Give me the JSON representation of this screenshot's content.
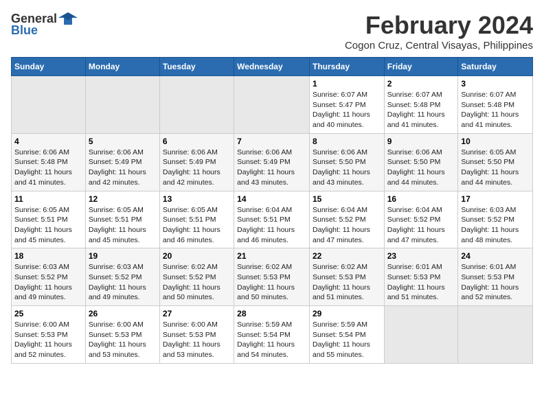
{
  "logo": {
    "text_general": "General",
    "text_blue": "Blue",
    "icon": "▶"
  },
  "title": "February 2024",
  "subtitle": "Cogon Cruz, Central Visayas, Philippines",
  "days_of_week": [
    "Sunday",
    "Monday",
    "Tuesday",
    "Wednesday",
    "Thursday",
    "Friday",
    "Saturday"
  ],
  "weeks": [
    [
      {
        "day": "",
        "info": ""
      },
      {
        "day": "",
        "info": ""
      },
      {
        "day": "",
        "info": ""
      },
      {
        "day": "",
        "info": ""
      },
      {
        "day": "1",
        "info": "Sunrise: 6:07 AM\nSunset: 5:47 PM\nDaylight: 11 hours and 40 minutes."
      },
      {
        "day": "2",
        "info": "Sunrise: 6:07 AM\nSunset: 5:48 PM\nDaylight: 11 hours and 41 minutes."
      },
      {
        "day": "3",
        "info": "Sunrise: 6:07 AM\nSunset: 5:48 PM\nDaylight: 11 hours and 41 minutes."
      }
    ],
    [
      {
        "day": "4",
        "info": "Sunrise: 6:06 AM\nSunset: 5:48 PM\nDaylight: 11 hours and 41 minutes."
      },
      {
        "day": "5",
        "info": "Sunrise: 6:06 AM\nSunset: 5:49 PM\nDaylight: 11 hours and 42 minutes."
      },
      {
        "day": "6",
        "info": "Sunrise: 6:06 AM\nSunset: 5:49 PM\nDaylight: 11 hours and 42 minutes."
      },
      {
        "day": "7",
        "info": "Sunrise: 6:06 AM\nSunset: 5:49 PM\nDaylight: 11 hours and 43 minutes."
      },
      {
        "day": "8",
        "info": "Sunrise: 6:06 AM\nSunset: 5:50 PM\nDaylight: 11 hours and 43 minutes."
      },
      {
        "day": "9",
        "info": "Sunrise: 6:06 AM\nSunset: 5:50 PM\nDaylight: 11 hours and 44 minutes."
      },
      {
        "day": "10",
        "info": "Sunrise: 6:05 AM\nSunset: 5:50 PM\nDaylight: 11 hours and 44 minutes."
      }
    ],
    [
      {
        "day": "11",
        "info": "Sunrise: 6:05 AM\nSunset: 5:51 PM\nDaylight: 11 hours and 45 minutes."
      },
      {
        "day": "12",
        "info": "Sunrise: 6:05 AM\nSunset: 5:51 PM\nDaylight: 11 hours and 45 minutes."
      },
      {
        "day": "13",
        "info": "Sunrise: 6:05 AM\nSunset: 5:51 PM\nDaylight: 11 hours and 46 minutes."
      },
      {
        "day": "14",
        "info": "Sunrise: 6:04 AM\nSunset: 5:51 PM\nDaylight: 11 hours and 46 minutes."
      },
      {
        "day": "15",
        "info": "Sunrise: 6:04 AM\nSunset: 5:52 PM\nDaylight: 11 hours and 47 minutes."
      },
      {
        "day": "16",
        "info": "Sunrise: 6:04 AM\nSunset: 5:52 PM\nDaylight: 11 hours and 47 minutes."
      },
      {
        "day": "17",
        "info": "Sunrise: 6:03 AM\nSunset: 5:52 PM\nDaylight: 11 hours and 48 minutes."
      }
    ],
    [
      {
        "day": "18",
        "info": "Sunrise: 6:03 AM\nSunset: 5:52 PM\nDaylight: 11 hours and 49 minutes."
      },
      {
        "day": "19",
        "info": "Sunrise: 6:03 AM\nSunset: 5:52 PM\nDaylight: 11 hours and 49 minutes."
      },
      {
        "day": "20",
        "info": "Sunrise: 6:02 AM\nSunset: 5:52 PM\nDaylight: 11 hours and 50 minutes."
      },
      {
        "day": "21",
        "info": "Sunrise: 6:02 AM\nSunset: 5:53 PM\nDaylight: 11 hours and 50 minutes."
      },
      {
        "day": "22",
        "info": "Sunrise: 6:02 AM\nSunset: 5:53 PM\nDaylight: 11 hours and 51 minutes."
      },
      {
        "day": "23",
        "info": "Sunrise: 6:01 AM\nSunset: 5:53 PM\nDaylight: 11 hours and 51 minutes."
      },
      {
        "day": "24",
        "info": "Sunrise: 6:01 AM\nSunset: 5:53 PM\nDaylight: 11 hours and 52 minutes."
      }
    ],
    [
      {
        "day": "25",
        "info": "Sunrise: 6:00 AM\nSunset: 5:53 PM\nDaylight: 11 hours and 52 minutes."
      },
      {
        "day": "26",
        "info": "Sunrise: 6:00 AM\nSunset: 5:53 PM\nDaylight: 11 hours and 53 minutes."
      },
      {
        "day": "27",
        "info": "Sunrise: 6:00 AM\nSunset: 5:53 PM\nDaylight: 11 hours and 53 minutes."
      },
      {
        "day": "28",
        "info": "Sunrise: 5:59 AM\nSunset: 5:54 PM\nDaylight: 11 hours and 54 minutes."
      },
      {
        "day": "29",
        "info": "Sunrise: 5:59 AM\nSunset: 5:54 PM\nDaylight: 11 hours and 55 minutes."
      },
      {
        "day": "",
        "info": ""
      },
      {
        "day": "",
        "info": ""
      }
    ]
  ]
}
